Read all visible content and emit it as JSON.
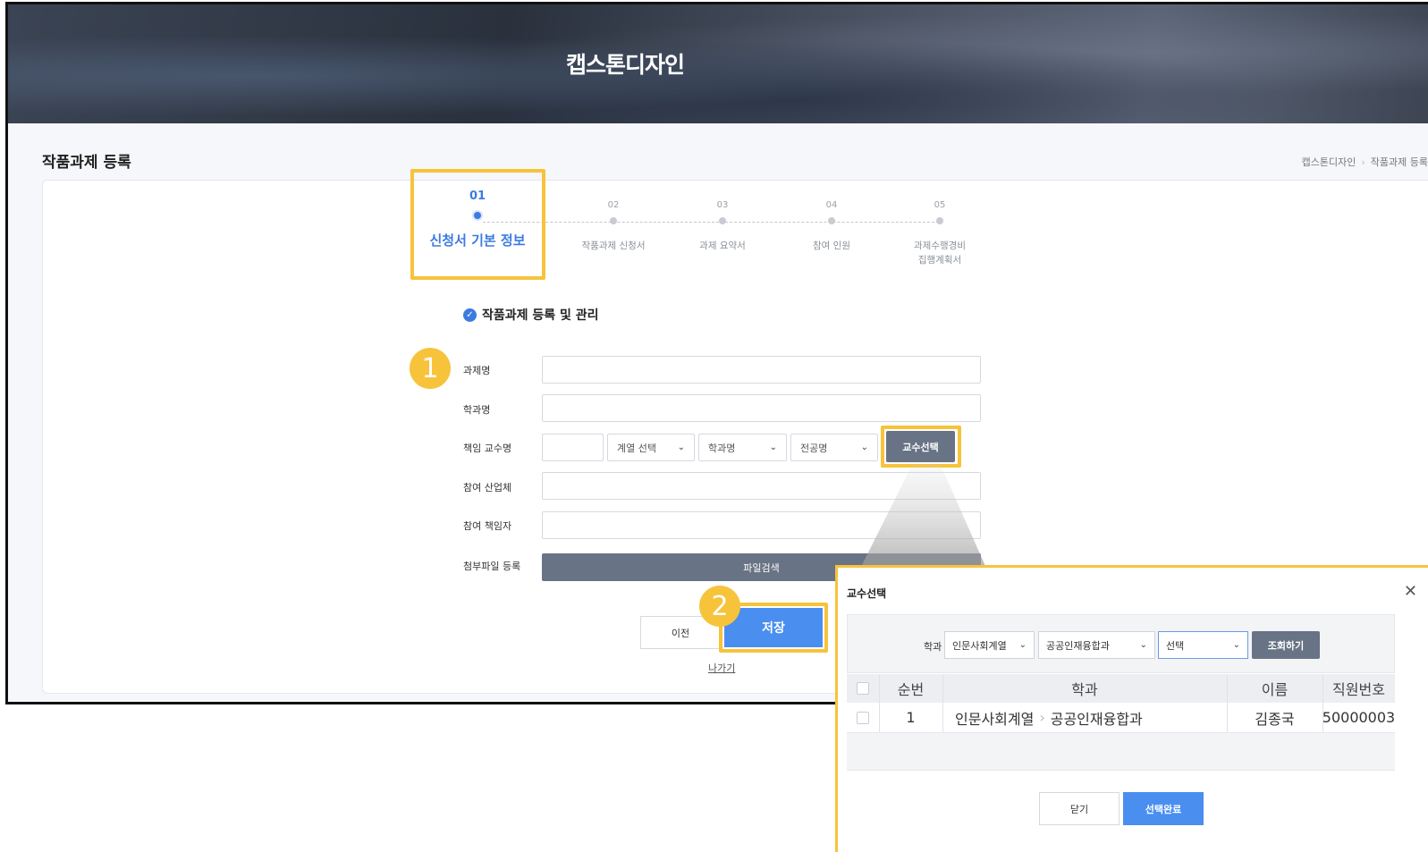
{
  "hero": {
    "title": "캡스톤디자인"
  },
  "page": {
    "title": "작품과제 등록"
  },
  "breadcrumb": {
    "items": [
      "캡스톤디자인",
      "작품과제 등록"
    ]
  },
  "steps": [
    {
      "num": "01",
      "label": "신청서 기본 정보",
      "active": true
    },
    {
      "num": "02",
      "label": "작품과제 신청서"
    },
    {
      "num": "03",
      "label": "과제 요약서"
    },
    {
      "num": "04",
      "label": "참여 인원"
    },
    {
      "num": "05",
      "label_line1": "과제수행경비",
      "label_line2": "집행계획서"
    }
  ],
  "section": {
    "title": "작품과제 등록 및 관리"
  },
  "badges": {
    "one": "1",
    "two": "2"
  },
  "form": {
    "project_name_label": "과제명",
    "dept_name_label": "학과명",
    "professor_label": "책임 교수명",
    "division_select": "계열 선택",
    "dept_select": "학과명",
    "major_select": "전공명",
    "select_professor_button": "교수선택",
    "company_label": "참여 산업체",
    "manager_label": "참여 책임자",
    "attachment_label": "첨부파일 등록",
    "file_search_button": "파일검색",
    "prev_button": "이전",
    "save_button": "저장",
    "exit_link": "나가기"
  },
  "modal": {
    "title": "교수선택",
    "filter_label": "학과",
    "filter_division": "인문사회계열",
    "filter_dept": "공공인재융합과",
    "filter_select": "선택",
    "search_button": "조회하기",
    "columns": [
      "순번",
      "학과",
      "이름",
      "직원번호"
    ],
    "rows": [
      {
        "no": "1",
        "division": "인문사회계열",
        "dept": "공공인재융합과",
        "name": "김종국",
        "emp_no": "50000003"
      }
    ],
    "close_button": "닫기",
    "confirm_button": "선택완료"
  },
  "colors": {
    "accent": "#3d7be0",
    "highlight": "#f6c33b",
    "dark_button": "#687385"
  }
}
